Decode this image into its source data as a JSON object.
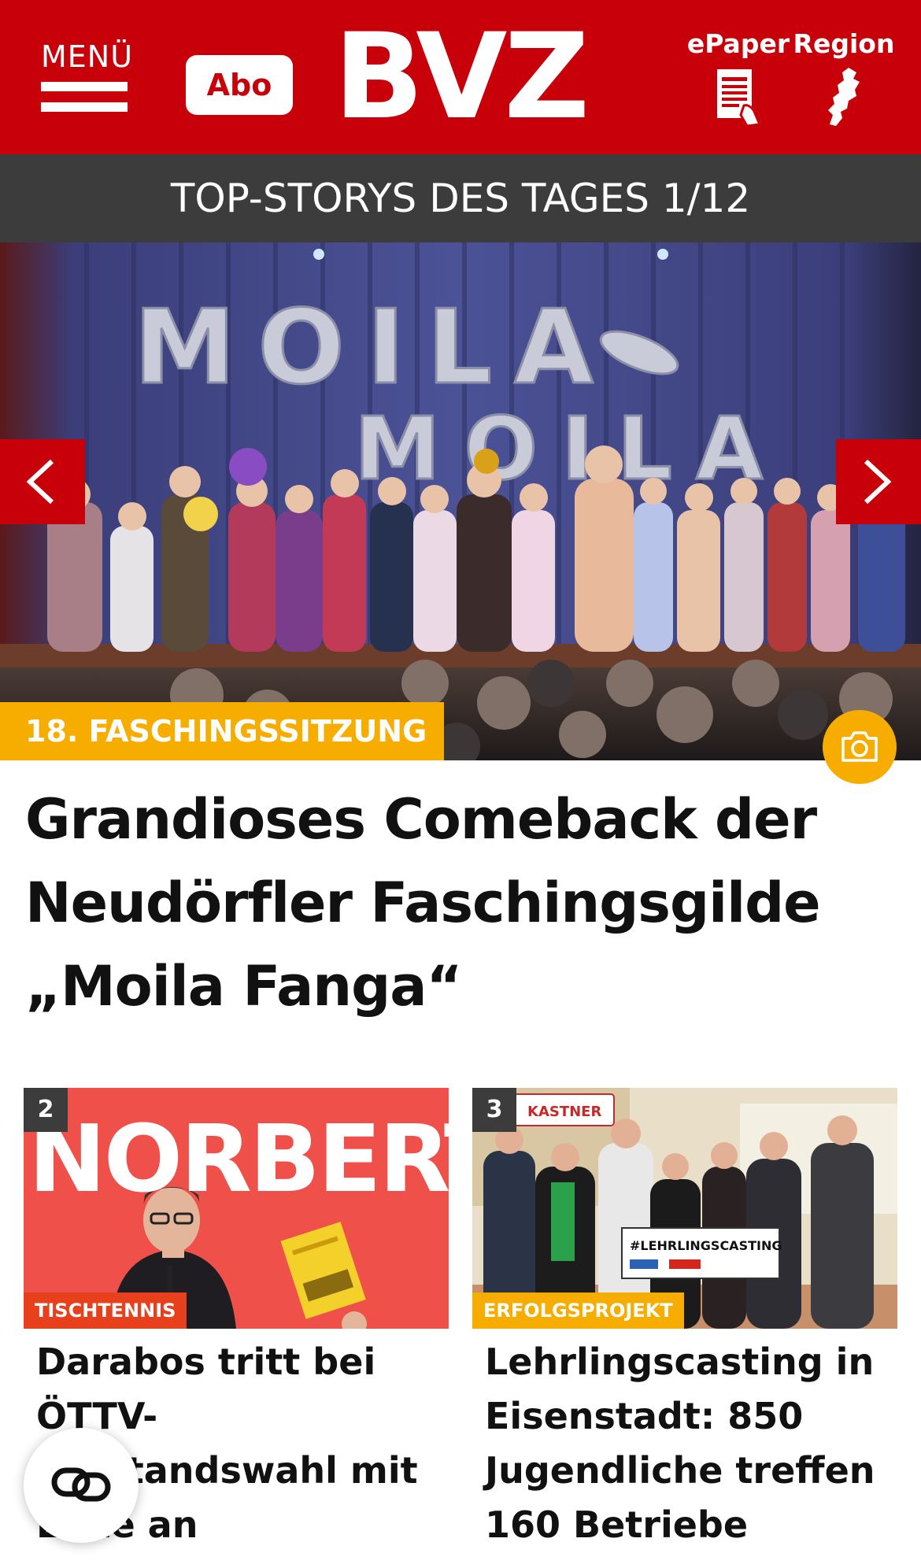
{
  "header": {
    "menu_label": "MENÜ",
    "abo_label": "Abo",
    "logo_text": "BVZ",
    "epaper_label": "ePaper",
    "region_label": "Region",
    "brand_color": "#c8000a"
  },
  "top_stories": {
    "heading": "TOP-STORYS DES TAGES 1/12"
  },
  "hero": {
    "kicker": "18. FASCHINGSSITZUNG",
    "title": "Grandioses Comeback der Neudörfler Faschingsgilde „Moila Fanga“",
    "image_text_row1": "MOILA",
    "image_text_row2": "MOILA",
    "accent_color": "#f7ad00"
  },
  "teasers": [
    {
      "rank": "2",
      "kicker": "TISCHTENNIS",
      "image_text": "NORBERT",
      "title": "Darabos tritt bei ÖTTV-Vorstandswahl mit Liste an"
    },
    {
      "rank": "3",
      "kicker": "ERFOLGSPROJEKT",
      "image_sign": "#LEHRLINGSCASTING",
      "image_banner": "KASTNER",
      "title": "Lehrlingscasting in Eisenstadt: 850 Jugendliche treffen 160 Betriebe"
    }
  ],
  "icons": {
    "menu": "hamburger-icon",
    "epaper": "epaper-icon",
    "region": "region-map-icon",
    "prev": "chevron-left-icon",
    "next": "chevron-right-icon",
    "camera": "camera-icon",
    "link": "link-icon"
  }
}
